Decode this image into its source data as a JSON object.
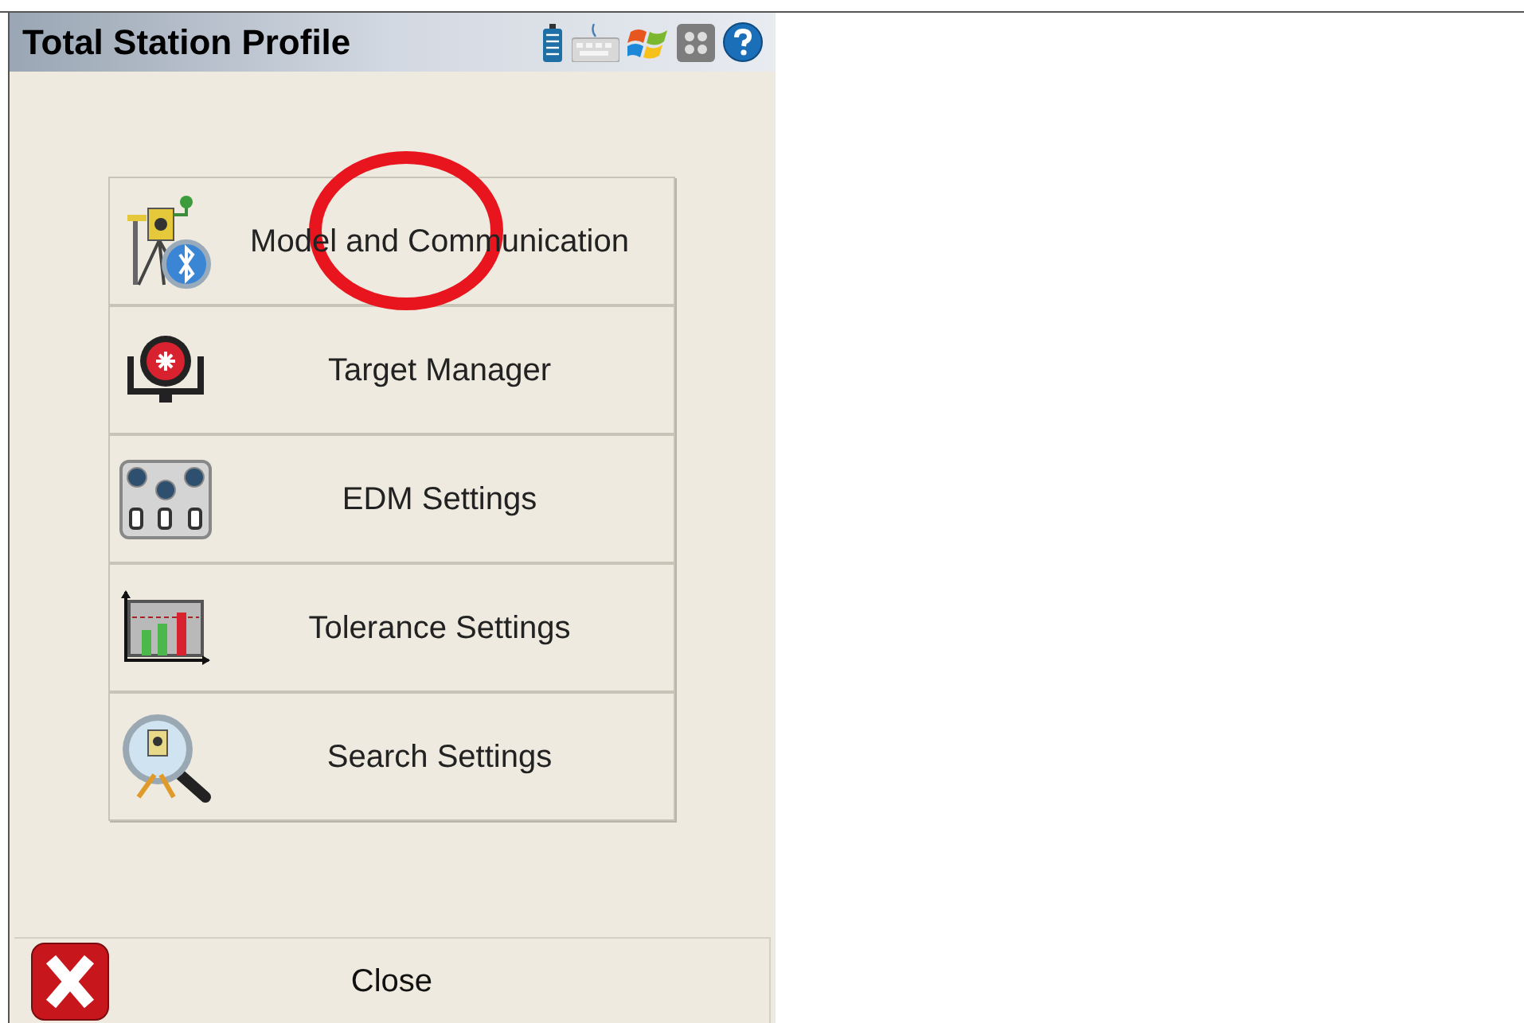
{
  "window": {
    "title": "Total Station Profile"
  },
  "status_icons": [
    {
      "kind": "battery"
    },
    {
      "kind": "keyboard"
    },
    {
      "kind": "start"
    },
    {
      "kind": "panel"
    },
    {
      "kind": "help"
    }
  ],
  "menu_items": [
    {
      "label": "Model and Communication",
      "kind": "instrument"
    },
    {
      "label": "Target Manager",
      "kind": "target"
    },
    {
      "label": "EDM Settings",
      "kind": "edm"
    },
    {
      "label": "Tolerance Settings",
      "kind": "tolerance"
    },
    {
      "label": "Search Settings",
      "kind": "search"
    }
  ],
  "close_button": {
    "label": "Close"
  }
}
